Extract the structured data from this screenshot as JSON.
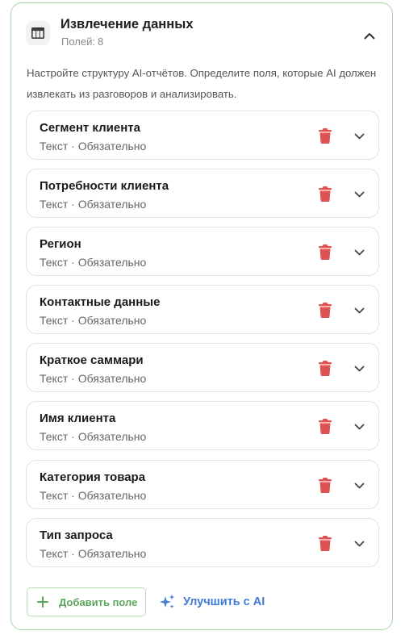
{
  "panel": {
    "title": "Извлечение данных",
    "subtitle_label": "Полей:",
    "subtitle_count": "8",
    "description": "Настройте структуру AI-отчётов. Определите поля, которые AI должен извлекать из разговоров и анализировать.",
    "icon": "table-icon",
    "accent_color": "#a9d6a6"
  },
  "fields": [
    {
      "name": "Сегмент клиента",
      "meta": "Текст · Обязательно"
    },
    {
      "name": "Потребности клиента",
      "meta": "Текст · Обязательно"
    },
    {
      "name": "Регион",
      "meta": "Текст · Обязательно"
    },
    {
      "name": "Контактные данные",
      "meta": "Текст · Обязательно"
    },
    {
      "name": "Краткое саммари",
      "meta": "Текст · Обязательно"
    },
    {
      "name": "Имя клиента",
      "meta": "Текст · Обязательно"
    },
    {
      "name": "Категория товара",
      "meta": "Текст · Обязательно"
    },
    {
      "name": "Тип запроса",
      "meta": "Текст · Обязательно"
    }
  ],
  "actions": {
    "add_field": "Добавить поле",
    "improve_ai": "Улучшить с AI"
  },
  "colors": {
    "delete": "#e05252",
    "ai_accent": "#3e7bd6",
    "add_accent": "#5aa658"
  }
}
